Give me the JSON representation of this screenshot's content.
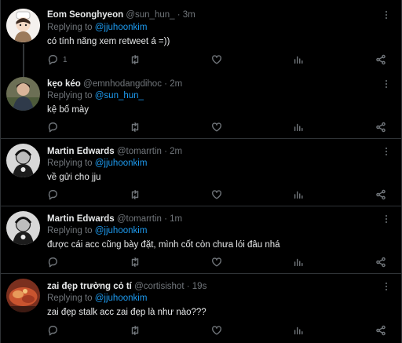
{
  "reply_prefix": "Replying to",
  "sep": "·",
  "tweets": [
    {
      "name": "Eom Seonghyeon",
      "handle": "@sun_hun_",
      "time": "3m",
      "reply_to": "@jjuhoonkim",
      "text": "có tính năng xem retweet á =))",
      "reply_count": "1",
      "avatar_icon": "chibi-avatar"
    },
    {
      "name": "kẹo kéo",
      "handle": "@emnhodangdihoc",
      "time": "2m",
      "reply_to": "@sun_hun_",
      "text": "kệ bố mày",
      "reply_count": "",
      "avatar_icon": "portrait-avatar"
    },
    {
      "name": "Martin Edwards",
      "handle": "@tomarrtin",
      "time": "2m",
      "reply_to": "@jjuhoonkim",
      "text": "về gửi cho jju",
      "reply_count": "",
      "avatar_icon": "sketch-avatar"
    },
    {
      "name": "Martin Edwards",
      "handle": "@tomarrtin",
      "time": "1m",
      "reply_to": "@jjuhoonkim",
      "text": "được cái acc cũng bày đặt, mình cốt còn chưa lói đâu nhá",
      "reply_count": "",
      "avatar_icon": "sketch-avatar"
    },
    {
      "name": "zai đẹp trường cỏ tí",
      "handle": "@cortisishot",
      "time": "19s",
      "reply_to": "@jjuhoonkim",
      "text": "zai đẹp stalk acc zai đẹp là như nào???",
      "reply_count": "",
      "avatar_icon": "food-avatar"
    }
  ]
}
